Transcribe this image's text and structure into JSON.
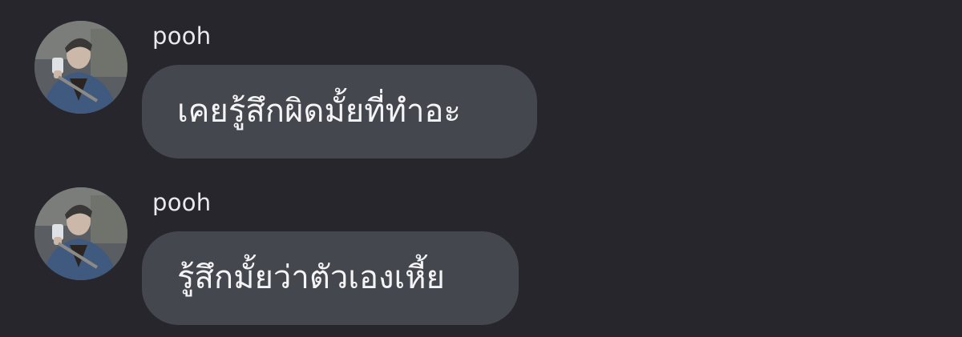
{
  "messages": [
    {
      "sender": "pooh",
      "text": "เคยรู้สึกผิดมั้ยที่ทำอะ",
      "avatar_icon": "user-photo-avatar"
    },
    {
      "sender": "pooh",
      "text": "รู้สึกมั้ยว่าตัวเองเหี้ย",
      "avatar_icon": "user-photo-avatar"
    }
  ],
  "colors": {
    "background": "#26262c",
    "bubble": "#45474e",
    "text": "#f4f4f6",
    "sender": "#e9e9ee"
  }
}
